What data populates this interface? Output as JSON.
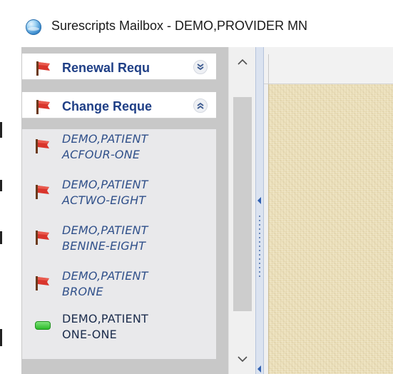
{
  "window": {
    "title": "Surescripts Mailbox - DEMO,PROVIDER MN",
    "app_icon": "globe-icon"
  },
  "nav": {
    "groups": [
      {
        "label": "Renewal Requ",
        "icon": "red-flag-icon",
        "state": "collapsed",
        "toggle_icon": "double-chevron-down-icon"
      },
      {
        "label": "Change Reque",
        "icon": "red-flag-icon",
        "state": "expanded",
        "toggle_icon": "double-chevron-up-icon"
      }
    ],
    "items": [
      {
        "line1": "DEMO,PATIENT",
        "line2": "ACFOUR-ONE",
        "icon": "red-flag-icon",
        "style": "italic"
      },
      {
        "line1": "DEMO,PATIENT",
        "line2": "ACTWO-EIGHT",
        "icon": "red-flag-icon",
        "style": "italic"
      },
      {
        "line1": "DEMO,PATIENT",
        "line2": "BENINE-EIGHT",
        "icon": "red-flag-icon",
        "style": "italic"
      },
      {
        "line1": "DEMO,PATIENT",
        "line2": "BRONE",
        "icon": "red-flag-icon",
        "style": "italic"
      },
      {
        "line1": "DEMO,PATIENT",
        "line2": "ONE-ONE",
        "icon": "green-status-icon",
        "style": "plain"
      }
    ]
  },
  "colors": {
    "group_label": "#1f3f86",
    "flag_red": "#d9352c",
    "status_green": "#2dbb2a",
    "paper_background": "#ece0bb"
  }
}
